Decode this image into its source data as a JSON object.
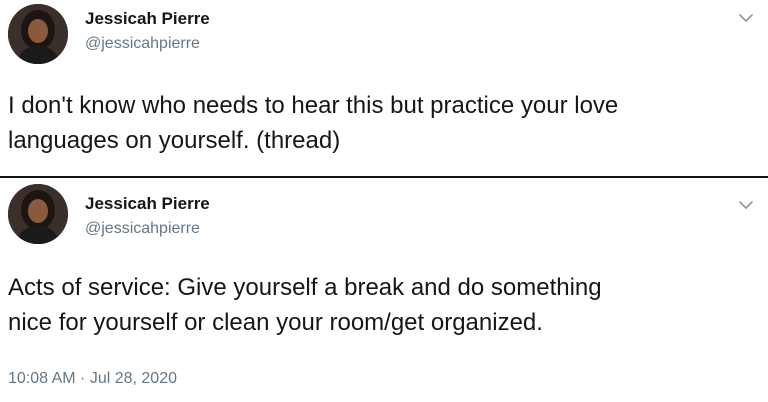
{
  "tweets": [
    {
      "author": {
        "name": "Jessicah Pierre",
        "handle": "@jessicahpierre"
      },
      "text_lines": [
        "I don't know who needs to hear this but practice your love",
        "languages on yourself.  (thread)"
      ]
    },
    {
      "author": {
        "name": "Jessicah Pierre",
        "handle": "@jessicahpierre"
      },
      "text_lines": [
        "Acts of service: Give yourself a break and do something",
        "nice for yourself or clean your room/get organized."
      ],
      "timestamp": "10:08 AM · Jul 28, 2020"
    }
  ],
  "icons": {
    "menu": "chevron-down-icon",
    "avatar": "profile-photo"
  },
  "colors": {
    "text_primary": "#14171a",
    "text_secondary": "#657786",
    "divider": "#111111"
  }
}
